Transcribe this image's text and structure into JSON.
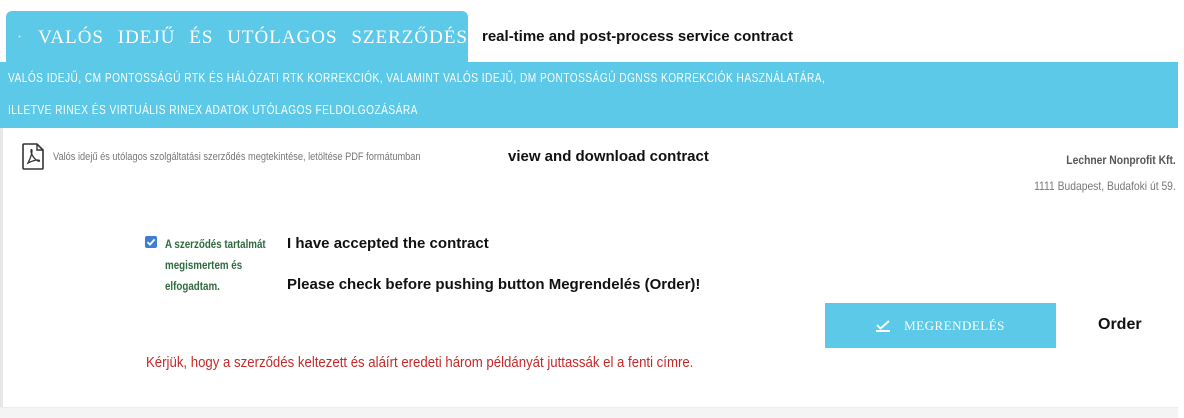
{
  "tab": {
    "title": "VALÓS IDEJŰ ÉS UTÓLAGOS SZERZŐDÉS",
    "icon": "compass-star-icon"
  },
  "annotations": {
    "tab": "real-time and post-process service contract",
    "pdf": "view and download contract",
    "accept": "I have accepted the contract",
    "check": "Please check before pushing button Megrendelés (Order)!",
    "order": "Order"
  },
  "banner": {
    "line1": "VALÓS IDEJŰ, CM PONTOSSÁGÚ RTK ÉS HÁLÓZATI RTK KORREKCIÓK, VALAMINT VALÓS IDEJŰ, DM PONTOSSÁGÚ DGNSS KORREKCIÓK HASZNÁLATÁRA,",
    "line2": "ILLETVE RINEX ÉS VIRTUÁLIS RINEX ADATOK UTÓLAGOS FELDOLGOZÁSÁRA"
  },
  "pdf": {
    "link_text": "Valós idejű és utólagos szolgáltatási szerződés megtekintése, letöltése PDF formátumban",
    "icon": "pdf-icon"
  },
  "company": {
    "name": "Lechner Nonprofit Kft.",
    "address": "1111 Budapest, Budafoki út 59."
  },
  "accept": {
    "checked": true,
    "line1": "A szerződés tartalmát",
    "line2": "megismertem és",
    "line3": "elfogadtam."
  },
  "order_button": {
    "label": "MEGRENDELÉS",
    "icon": "check-mark-icon"
  },
  "notice": "Kérjük, hogy a szerződés keltezett és aláírt eredeti három példányát juttassák el a fenti címre.",
  "colors": {
    "accent": "#5bc9e7",
    "notice": "#c62828",
    "accept_text": "#2f6b3f",
    "checkbox": "#3b7ed6"
  }
}
